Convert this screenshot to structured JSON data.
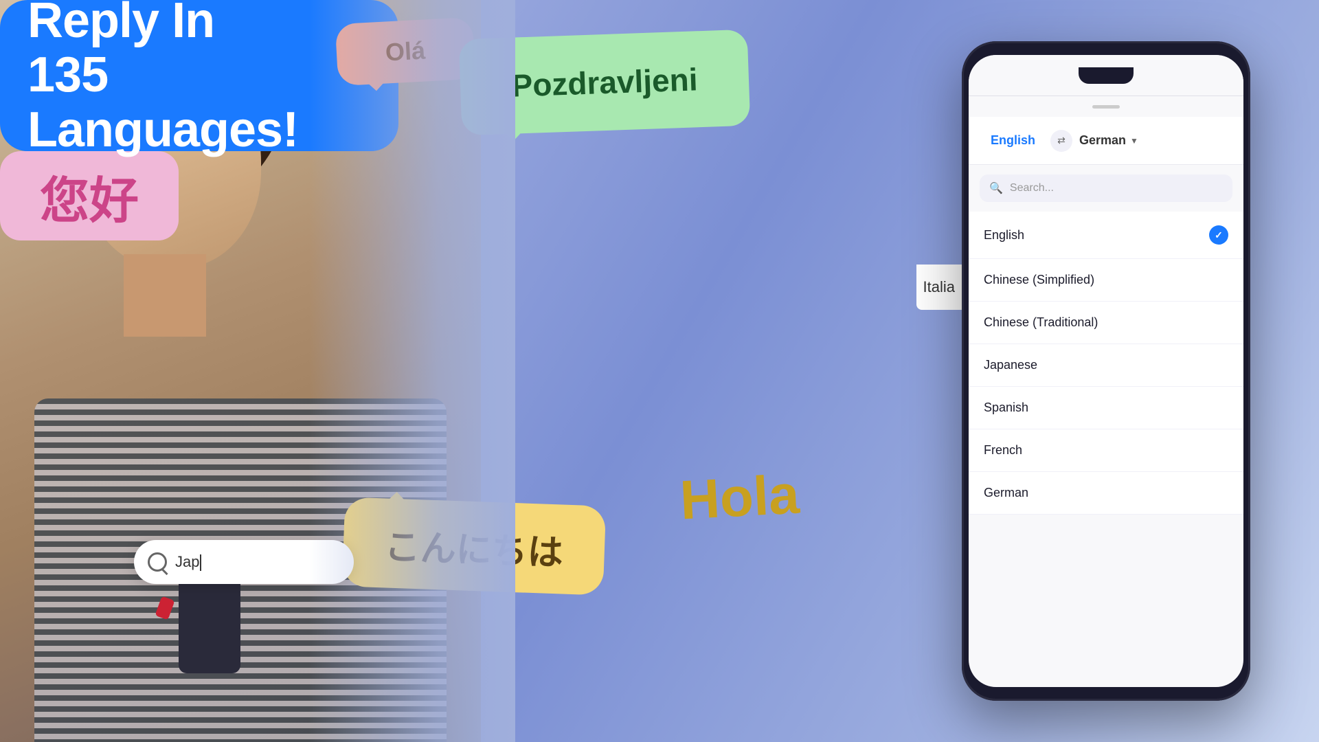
{
  "background": {
    "gradient_start": "#c5cff0",
    "gradient_end": "#9fb0e0"
  },
  "bubbles": {
    "ola": {
      "text": "Olá",
      "color": "#f0a898",
      "text_color": "#8B4513"
    },
    "pozdravljeni": {
      "text": "Pozdravljeni",
      "color": "#a8e8b0",
      "text_color": "#1a5a2a"
    },
    "headline_line1": "Reply In",
    "headline_line2": "135 Languages!",
    "japanese": {
      "text": "こんにちは",
      "color": "#f5d878",
      "text_color": "#5a4010"
    },
    "hola": {
      "text": "Hola",
      "color": "#c8a020"
    },
    "nihao": {
      "text": "您好",
      "color": "#f0b8d8",
      "text_color": "#cc4488"
    }
  },
  "search_bar": {
    "text": "Jap",
    "placeholder": "Search..."
  },
  "phone": {
    "header": {
      "source_lang": "English",
      "swap_symbol": "⇄",
      "target_lang": "German"
    },
    "search_placeholder": "Search...",
    "languages": [
      {
        "name": "English",
        "selected": true
      },
      {
        "name": "Chinese (Simplified)",
        "selected": false
      },
      {
        "name": "Chinese (Traditional)",
        "selected": false
      },
      {
        "name": "Japanese",
        "selected": false
      },
      {
        "name": "Spanish",
        "selected": false
      },
      {
        "name": "French",
        "selected": false
      },
      {
        "name": "German",
        "selected": false
      }
    ]
  },
  "italian_partial": "Italia"
}
